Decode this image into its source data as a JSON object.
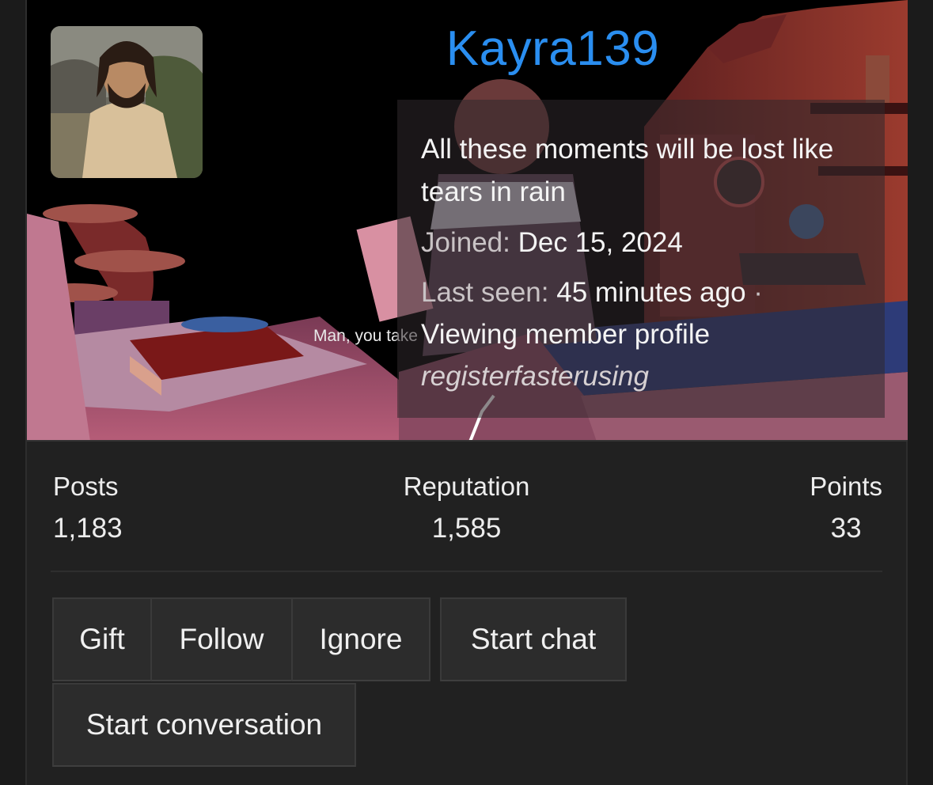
{
  "profile": {
    "username": "Kayra139",
    "tagline": "All these moments will be lost like tears in rain",
    "joined_label": "Joined:",
    "joined_value": "Dec 15, 2024",
    "last_seen_label": "Last seen:",
    "last_seen_value": "45 minutes ago",
    "separator": "·",
    "activity": "Viewing member profile",
    "signature_link": "registerfasterusing",
    "banner_subtitle": "Man, you take"
  },
  "stats": {
    "posts_label": "Posts",
    "posts_value": "1,183",
    "reputation_label": "Reputation",
    "reputation_value": "1,585",
    "points_label": "Points",
    "points_value": "33"
  },
  "actions": {
    "gift": "Gift",
    "follow": "Follow",
    "ignore": "Ignore",
    "start_chat": "Start chat",
    "start_conversation": "Start conversation"
  },
  "colors": {
    "username": "#2a8ef0",
    "background": "#212121",
    "button": "#2c2c2c"
  }
}
